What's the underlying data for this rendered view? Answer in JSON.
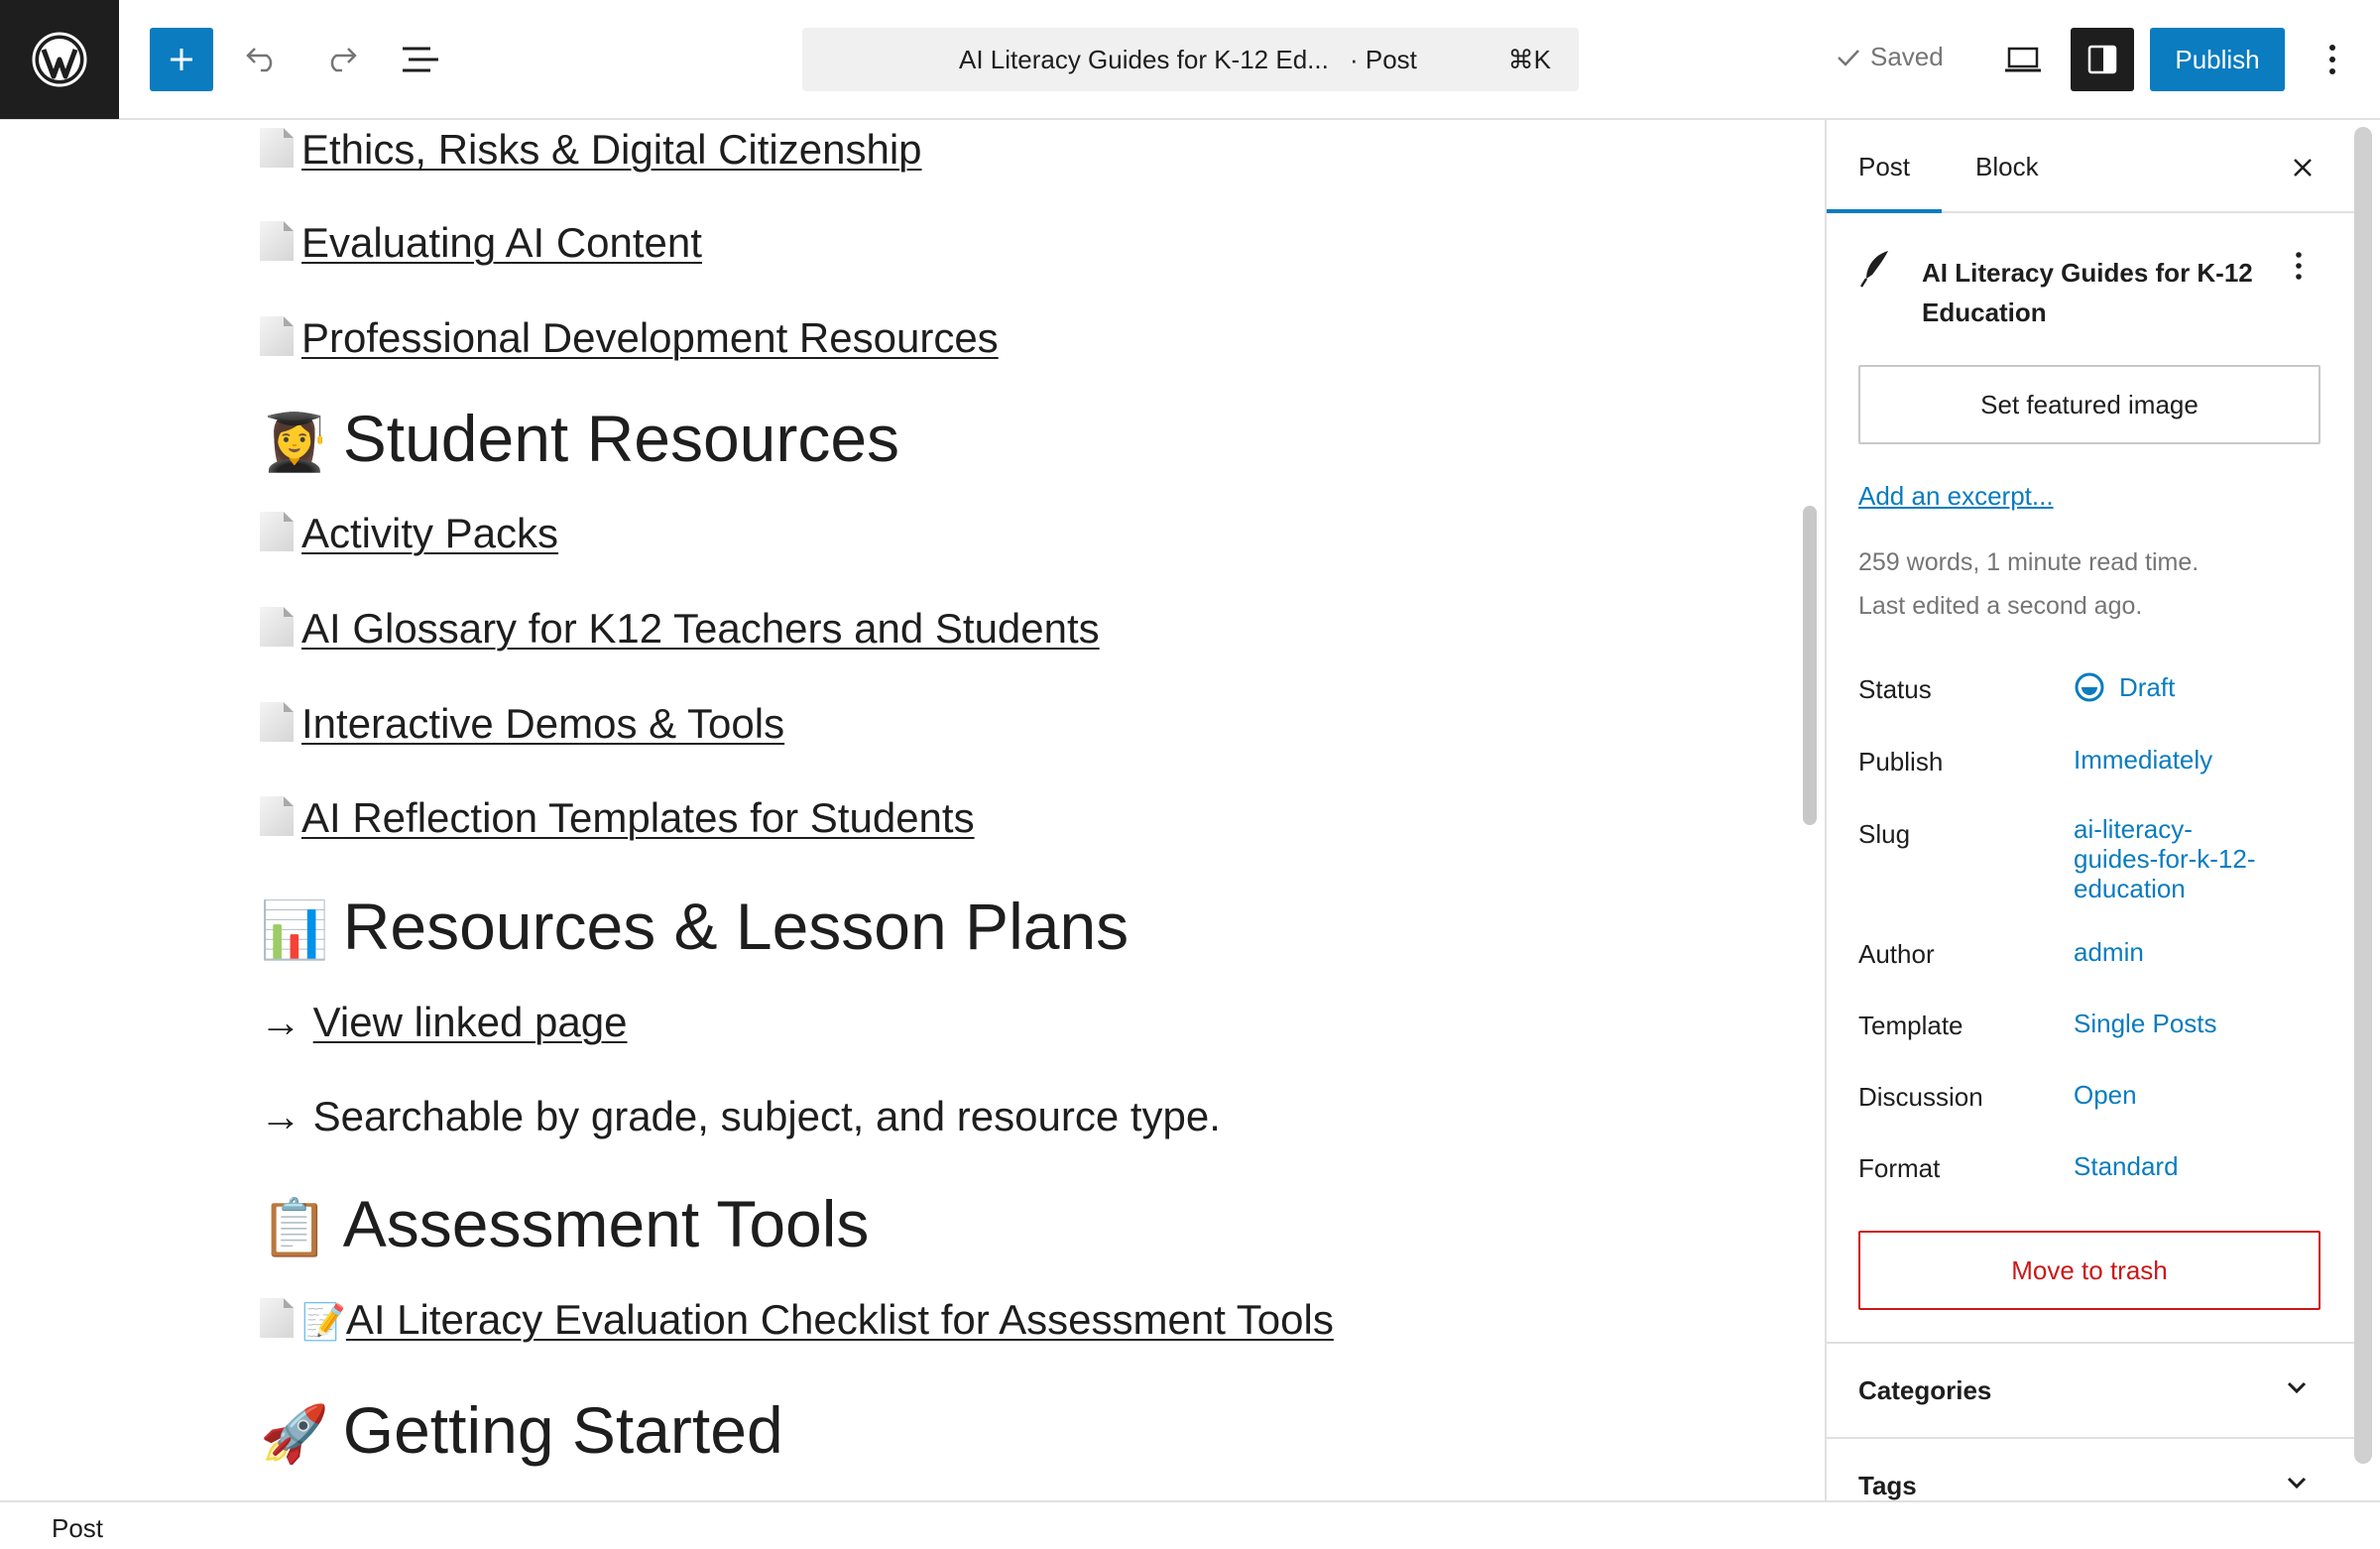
{
  "header": {
    "command_title": "AI Literacy Guides for K-12 Ed...",
    "command_type": "· Post",
    "command_shortcut": "⌘K",
    "saved_label": "Saved",
    "publish_label": "Publish"
  },
  "content": {
    "blocks": [
      {
        "type": "link",
        "text": "Ethics, Risks & Digital Citizenship"
      },
      {
        "type": "link",
        "text": "Evaluating AI Content"
      },
      {
        "type": "link",
        "text": "Professional Development Resources"
      },
      {
        "type": "heading",
        "emoji": "👩‍🎓",
        "text": "Student Resources"
      },
      {
        "type": "link",
        "text": "Activity Packs"
      },
      {
        "type": "link",
        "text": "AI Glossary for K12 Teachers and Students"
      },
      {
        "type": "link",
        "text": "Interactive Demos & Tools"
      },
      {
        "type": "link",
        "text": "AI Reflection Templates for Students"
      },
      {
        "type": "heading",
        "emoji": "📊",
        "text": "Resources & Lesson Plans"
      },
      {
        "type": "arrow-link",
        "arrow": "→",
        "text": "View linked page"
      },
      {
        "type": "arrow-text",
        "arrow": "→",
        "text": "Searchable by grade, subject, and resource type."
      },
      {
        "type": "heading",
        "emoji": "📋",
        "text": "Assessment Tools"
      },
      {
        "type": "link-emoji",
        "emoji": "📝",
        "text": "AI Literacy Evaluation Checklist for Assessment Tools"
      },
      {
        "type": "heading",
        "emoji": "🚀",
        "text": "Getting Started"
      }
    ]
  },
  "sidebar": {
    "tab_post": "Post",
    "tab_block": "Block",
    "post_title": "AI Literacy Guides for K-12 Education",
    "featured_image_label": "Set featured image",
    "excerpt_link": "Add an excerpt...",
    "word_count": "259 words, 1 minute read time.",
    "last_edited": "Last edited a second ago.",
    "rows": {
      "status": {
        "label": "Status",
        "value": "Draft"
      },
      "publish": {
        "label": "Publish",
        "value": "Immediately"
      },
      "slug": {
        "label": "Slug",
        "value_line1": "ai-literacy-",
        "value_line2": "guides-for-k-12-",
        "value_line3": "education"
      },
      "author": {
        "label": "Author",
        "value": "admin"
      },
      "template": {
        "label": "Template",
        "value": "Single Posts"
      },
      "discussion": {
        "label": "Discussion",
        "value": "Open"
      },
      "format": {
        "label": "Format",
        "value": "Standard"
      }
    },
    "trash_label": "Move to trash",
    "panels": {
      "categories": "Categories",
      "tags": "Tags"
    }
  },
  "footer": {
    "breadcrumb": "Post"
  },
  "colors": {
    "accent": "#0a7cbf",
    "danger": "#cc1818",
    "dark": "#1e1e1e"
  }
}
